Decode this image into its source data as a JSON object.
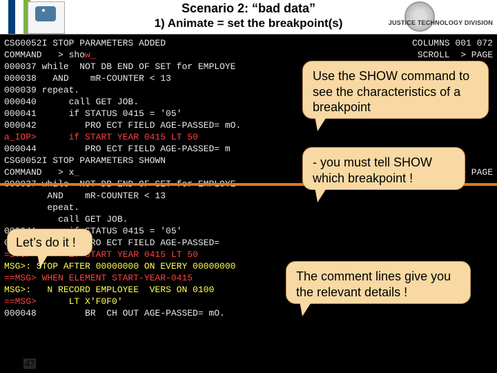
{
  "header": {
    "title1": "Scenario 2: “bad data”",
    "title2": "1) Animate = set the breakpoint(s)",
    "justice": "JUSTICE TECHNOLOGY DIVISION"
  },
  "terminal": {
    "l01a": "CSG0052I STOP PARAMETERS ADDED",
    "l01b": "COLUMNS 001 072",
    "l02a": "COMMAND   > sho",
    "l02b": "w_",
    "l02c": "SCROLL  > PAGE",
    "l03": "000037 while  NOT DB END OF SET for EMPLOYE",
    "l04": "000038   AND    mR-COUNTER < 13",
    "l05": "000039 repeat.",
    "l06": "000040      call GET JOB.",
    "l07": "000041      if STATUS 0415 = '05'",
    "l08": "000042         PRO ECT FIELD AGE-PASSED= mO.",
    "l09": "a_IOP>      if START YEAR 0415 LT 50",
    "l10": "000044         PRO ECT FIELD AGE-PASSED= m",
    "l11": "",
    "l12": "CSG0052I STOP PARAMETERS SHOWN",
    "l13a": "COMMAND   > x",
    "l13b": "_",
    "l13c": "SCROLL  > PAGE",
    "l14": "000037 while  NOT DB END OF SET for EMPLOYE",
    "l15": "        AND    mR-COUNTER < 13",
    "l16": "        epeat.",
    "l17": "          call GET JOB.",
    "l18": "000041      if STATUS 0415 = '05'",
    "l19": "000042         PRO ECT FIELD AGE-PASSED=",
    "l20": "=STOP>      if START YEAR 0415 LT 50",
    "l21": "MSG>: STOP AFTER 00000000 ON EVERY 00000000",
    "l22": "==MSG> WHEN ELEMENT START-YEAR-0415",
    "l23": "MSG>:   N RECORD EMPLOYEE  VERS ON 0100",
    "l24a": "==MSG>",
    "l24b": "      LT X'F0F0'",
    "l25": "000048         BR  CH OUT AGE-PASSED= mO."
  },
  "callouts": {
    "c1": "Use the SHOW command to see the characteristics of a breakpoint",
    "c2": "- you must tell SHOW which breakpoint !",
    "c3": "Let’s do it !",
    "c4": "The comment lines give you the relevant details !"
  },
  "slide_number": "47"
}
